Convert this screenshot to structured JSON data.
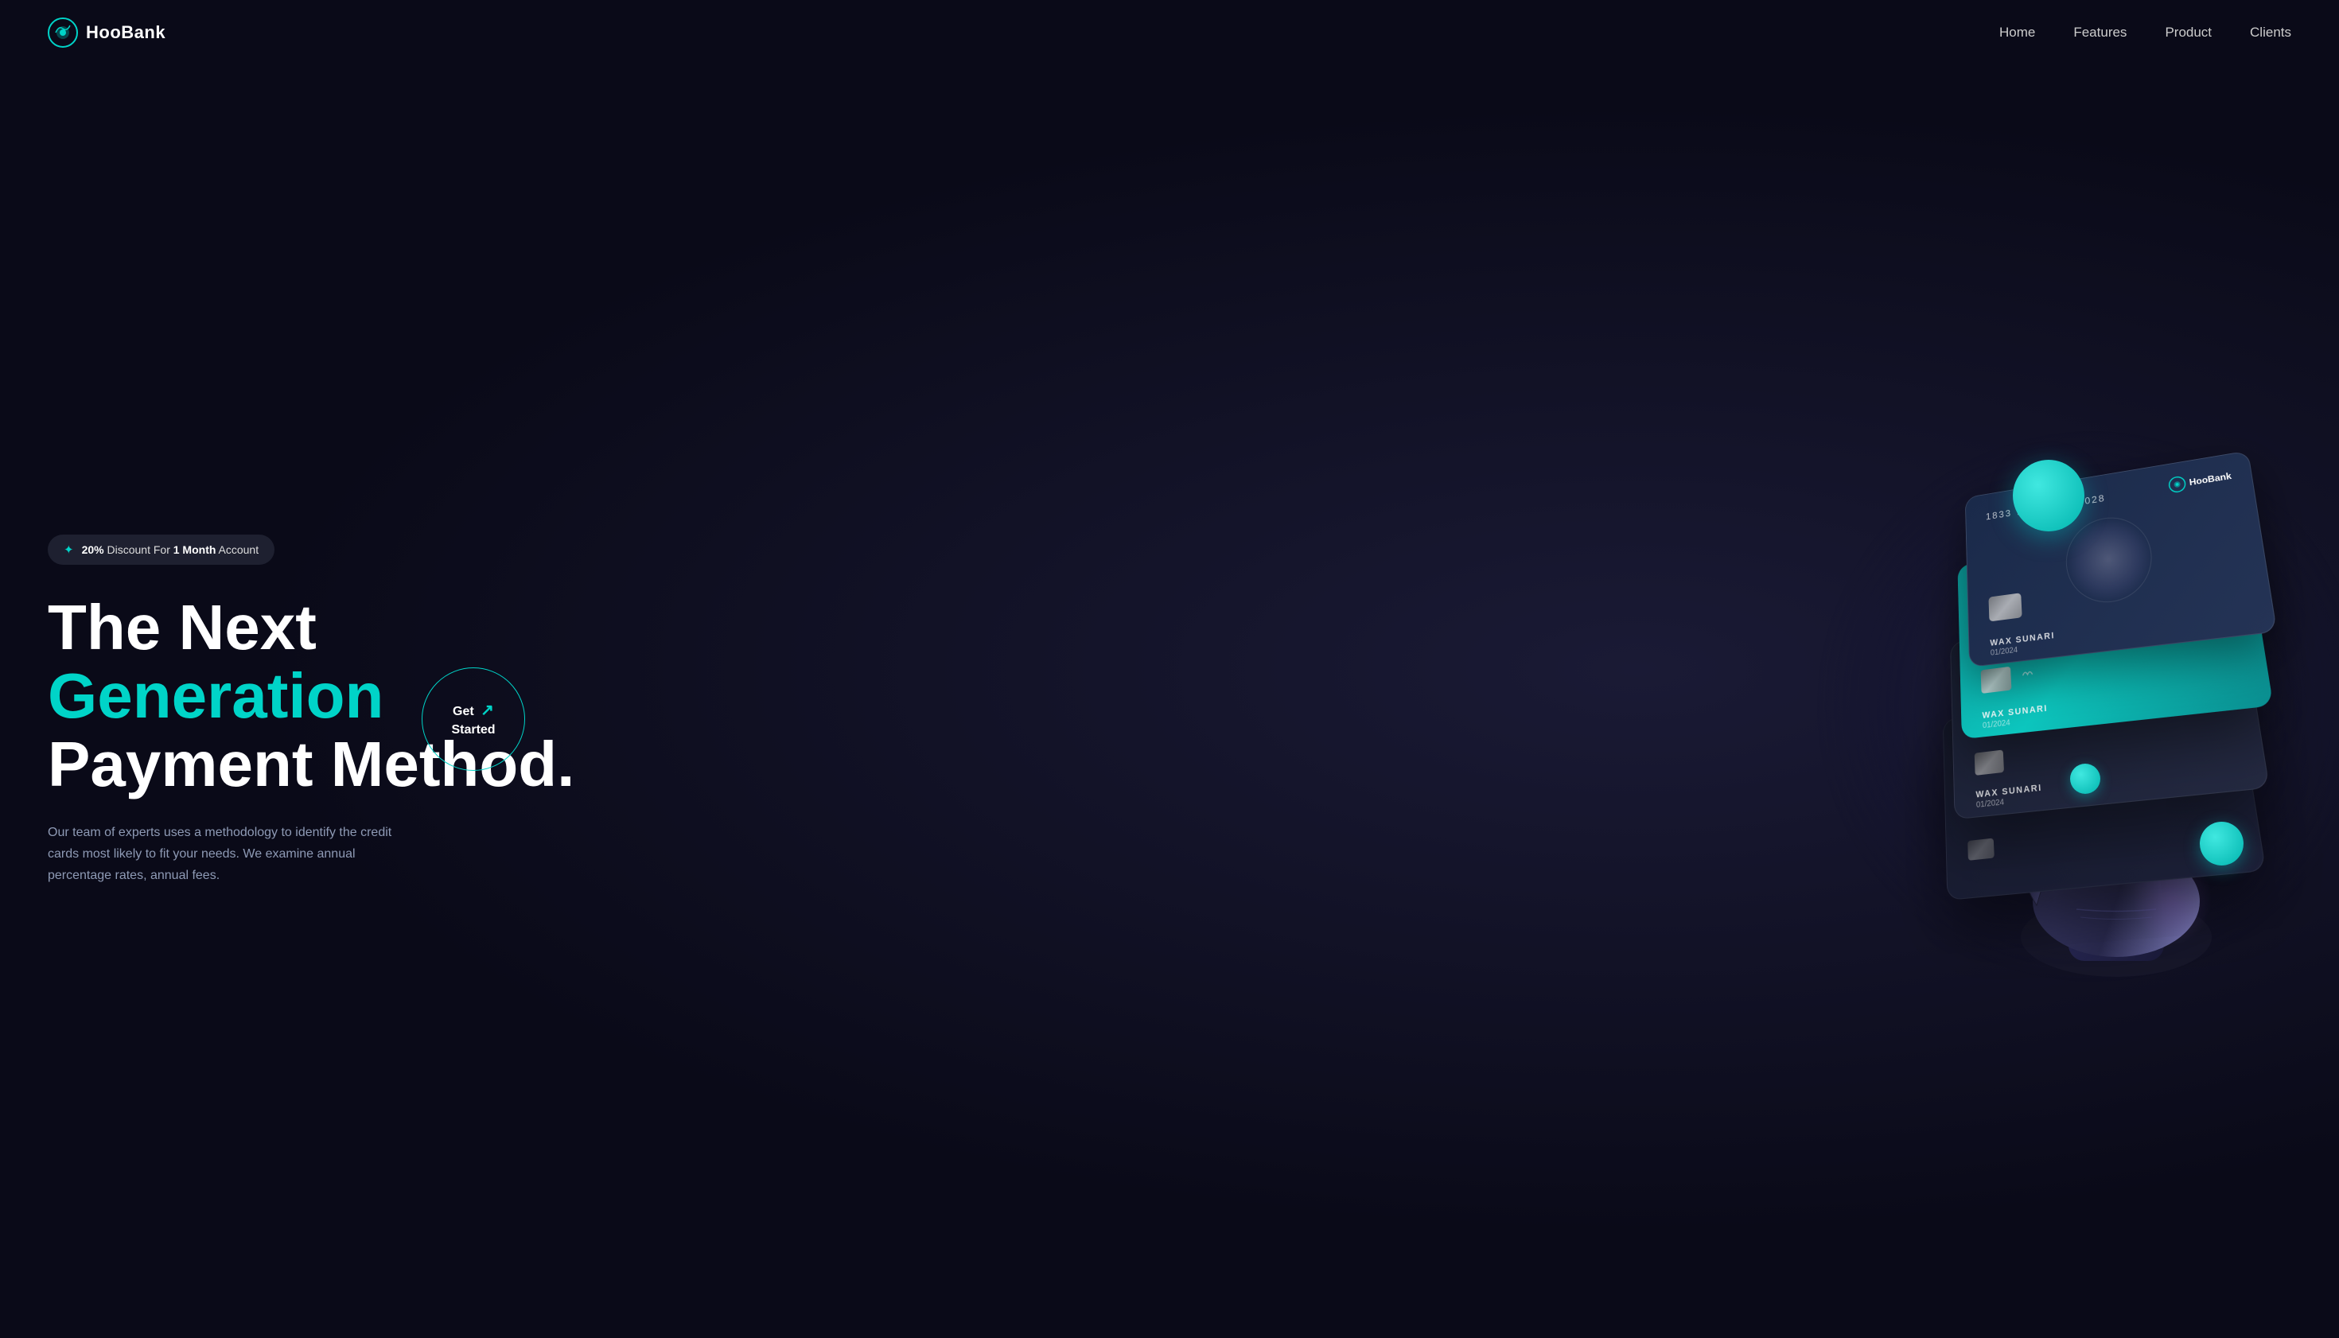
{
  "logo": {
    "text": "HooBank",
    "icon_name": "hoobank-logo-icon"
  },
  "nav": {
    "links": [
      {
        "label": "Home",
        "id": "nav-home"
      },
      {
        "label": "Features",
        "id": "nav-features"
      },
      {
        "label": "Product",
        "id": "nav-product"
      },
      {
        "label": "Clients",
        "id": "nav-clients"
      }
    ]
  },
  "hero": {
    "badge": {
      "icon": "✦",
      "text_pre": "",
      "highlight1": "20%",
      "text_mid": " Discount For ",
      "highlight2": "1 Month",
      "text_end": " Account"
    },
    "heading": {
      "line1": "The Next",
      "line2": "Generation",
      "line3": "Payment Method."
    },
    "description": "Our team of experts uses a methodology to identify the credit cards most likely to fit your needs. We examine annual percentage rates, annual fees.",
    "cta": {
      "label_line1": "Get",
      "label_line2": "Started",
      "arrow": "↗"
    }
  },
  "cards": [
    {
      "number": "1833 7163 3882 1028",
      "owner": "WAX SUNARI",
      "date": "01/2024",
      "type": "top-dark"
    },
    {
      "number": "",
      "owner": "WAX SUNARI",
      "date": "01/2024",
      "type": "teal"
    },
    {
      "number": "",
      "owner": "WAX SUNARI",
      "date": "01/2024",
      "type": "dark2"
    },
    {
      "number": "",
      "owner": "",
      "date": "",
      "type": "dark3"
    }
  ],
  "orbs": {
    "top": {
      "size": 90,
      "color": "#00d4c8"
    },
    "mid": {
      "size": 55,
      "color": "#00d4c8"
    },
    "small": {
      "size": 38,
      "color": "#00d4c8"
    }
  },
  "colors": {
    "accent": "#00d4c8",
    "bg_dark": "#0a0a18",
    "bg_mid": "#1a1a35",
    "text_muted": "#8e9ab5"
  }
}
